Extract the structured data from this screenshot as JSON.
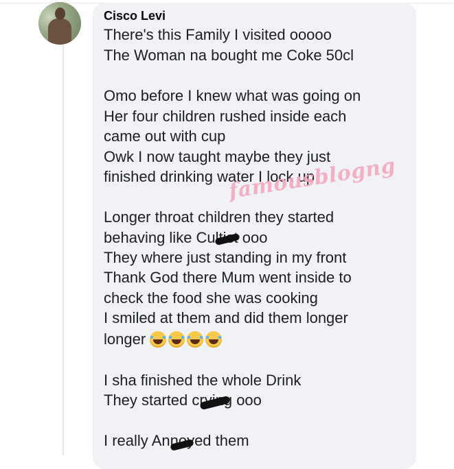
{
  "comment": {
    "author": "Cisco Levi",
    "lines": [
      "There's this Family I visited ooooo",
      "The Woman na bought me Coke 50cl",
      "Omo before I knew what was going on",
      "Her four children rushed inside each",
      "came out with cup",
      "Owk I now taught maybe they just",
      "finished drinking water I lock up",
      "Longer throat children they started",
      "behaving like Cultist ooo",
      "They where just standing in my front",
      "Thank God there Mum went inside to",
      "check the food she was cooking",
      "I smiled at them and did them longer",
      "longer",
      "I sha finished the whole Drink",
      "They started crying ooo",
      "I really Annoyed them"
    ],
    "emoji": "face-with-tears-of-joy-icon"
  },
  "watermark": "famousblogng",
  "colors": {
    "bubble": "#f0f2f5",
    "text": "#1c1e21",
    "watermark": "#f4a8c0"
  }
}
